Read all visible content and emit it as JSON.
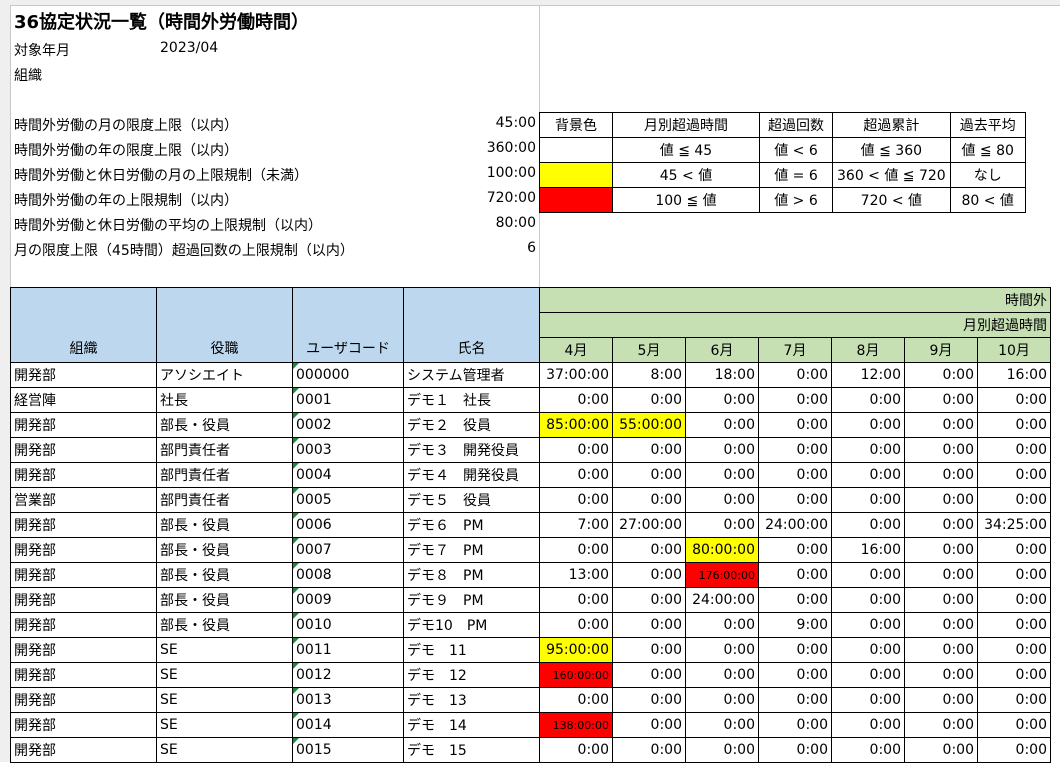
{
  "title": "36協定状況一覧（時間外労働時間）",
  "target_month_label": "対象年月",
  "target_month_value": "2023/04",
  "org_label": "組織",
  "limits": [
    {
      "label": "時間外労働の月の限度上限（以内）",
      "value": "45:00"
    },
    {
      "label": "時間外労働の年の限度上限（以内）",
      "value": "360:00"
    },
    {
      "label": "時間外労働と休日労働の月の上限規制（未満）",
      "value": "100:00"
    },
    {
      "label": "時間外労働の年の上限規制（以内）",
      "value": "720:00"
    },
    {
      "label": "時間外労働と休日労働の平均の上限規制（以内）",
      "value": "80:00"
    },
    {
      "label": "月の限度上限（45時間）超過回数の上限規制（以内）",
      "value": "6"
    }
  ],
  "legend": {
    "headers": [
      "背景色",
      "月別超過時間",
      "超過回数",
      "超過累計",
      "過去平均"
    ],
    "rows": [
      {
        "color": "#ffffff",
        "cells": [
          "値 ≦ 45",
          "値 < 6",
          "値 ≦ 360",
          "値 ≦ 80"
        ]
      },
      {
        "color": "#ffff00",
        "cells": [
          "45 < 値",
          "値 = 6",
          "360 < 値 ≦ 720",
          "なし"
        ]
      },
      {
        "color": "#ff0000",
        "cells": [
          "100 ≦ 値",
          "値 > 6",
          "720 < 値",
          "80 < 値"
        ]
      }
    ]
  },
  "grid": {
    "group_header": "時間外",
    "sub_header": "月別超過時間",
    "columns": [
      "組織",
      "役職",
      "ユーザコード",
      "氏名"
    ],
    "months": [
      "4月",
      "5月",
      "6月",
      "7月",
      "8月",
      "9月",
      "10月"
    ],
    "rows": [
      {
        "org": "開発部",
        "role": "アソシエイト",
        "code": "000000",
        "name": "システム管理者",
        "vals": [
          "37:00:00",
          "8:00",
          "18:00",
          "0:00",
          "12:00",
          "0:00",
          "16:00"
        ],
        "hl": [
          "",
          "",
          "",
          "",
          "",
          "",
          ""
        ]
      },
      {
        "org": "経営陣",
        "role": "社長",
        "code": "0001",
        "name": "デモ１　社長",
        "vals": [
          "0:00",
          "0:00",
          "0:00",
          "0:00",
          "0:00",
          "0:00",
          "0:00"
        ],
        "hl": [
          "",
          "",
          "",
          "",
          "",
          "",
          ""
        ]
      },
      {
        "org": "開発部",
        "role": "部長・役員",
        "code": "0002",
        "name": "デモ２　役員",
        "vals": [
          "85:00:00",
          "55:00:00",
          "0:00",
          "0:00",
          "0:00",
          "0:00",
          "0:00"
        ],
        "hl": [
          "y",
          "y",
          "",
          "",
          "",
          "",
          ""
        ]
      },
      {
        "org": "開発部",
        "role": "部門責任者",
        "code": "0003",
        "name": "デモ３　開発役員",
        "vals": [
          "0:00",
          "0:00",
          "0:00",
          "0:00",
          "0:00",
          "0:00",
          "0:00"
        ],
        "hl": [
          "",
          "",
          "",
          "",
          "",
          "",
          ""
        ]
      },
      {
        "org": "開発部",
        "role": "部門責任者",
        "code": "0004",
        "name": "デモ４　開発役員",
        "vals": [
          "0:00",
          "0:00",
          "0:00",
          "0:00",
          "0:00",
          "0:00",
          "0:00"
        ],
        "hl": [
          "",
          "",
          "",
          "",
          "",
          "",
          ""
        ]
      },
      {
        "org": "営業部",
        "role": "部門責任者",
        "code": "0005",
        "name": "デモ５　役員",
        "vals": [
          "0:00",
          "0:00",
          "0:00",
          "0:00",
          "0:00",
          "0:00",
          "0:00"
        ],
        "hl": [
          "",
          "",
          "",
          "",
          "",
          "",
          ""
        ]
      },
      {
        "org": "開発部",
        "role": "部長・役員",
        "code": "0006",
        "name": "デモ６　PM",
        "vals": [
          "7:00",
          "27:00:00",
          "0:00",
          "24:00:00",
          "0:00",
          "0:00",
          "34:25:00"
        ],
        "hl": [
          "",
          "",
          "",
          "",
          "",
          "",
          ""
        ]
      },
      {
        "org": "開発部",
        "role": "部長・役員",
        "code": "0007",
        "name": "デモ７　PM",
        "vals": [
          "0:00",
          "0:00",
          "80:00:00",
          "0:00",
          "16:00",
          "0:00",
          "0:00"
        ],
        "hl": [
          "",
          "",
          "y",
          "",
          "",
          "",
          ""
        ]
      },
      {
        "org": "開発部",
        "role": "部長・役員",
        "code": "0008",
        "name": "デモ８　PM",
        "vals": [
          "13:00",
          "0:00",
          "176:00:00",
          "0:00",
          "0:00",
          "0:00",
          "0:00"
        ],
        "hl": [
          "",
          "",
          "r",
          "",
          "",
          "",
          ""
        ]
      },
      {
        "org": "開発部",
        "role": "部長・役員",
        "code": "0009",
        "name": "デモ９　PM",
        "vals": [
          "0:00",
          "0:00",
          "24:00:00",
          "0:00",
          "0:00",
          "0:00",
          "0:00"
        ],
        "hl": [
          "",
          "",
          "",
          "",
          "",
          "",
          ""
        ]
      },
      {
        "org": "開発部",
        "role": "部長・役員",
        "code": "0010",
        "name": "デモ10　PM",
        "vals": [
          "0:00",
          "0:00",
          "0:00",
          "9:00",
          "0:00",
          "0:00",
          "0:00"
        ],
        "hl": [
          "",
          "",
          "",
          "",
          "",
          "",
          ""
        ]
      },
      {
        "org": "開発部",
        "role": "SE",
        "code": "0011",
        "name": "デモ　11",
        "vals": [
          "95:00:00",
          "0:00",
          "0:00",
          "0:00",
          "0:00",
          "0:00",
          "0:00"
        ],
        "hl": [
          "y",
          "",
          "",
          "",
          "",
          "",
          ""
        ]
      },
      {
        "org": "開発部",
        "role": "SE",
        "code": "0012",
        "name": "デモ　12",
        "vals": [
          "160:00:00",
          "0:00",
          "0:00",
          "0:00",
          "0:00",
          "0:00",
          "0:00"
        ],
        "hl": [
          "r",
          "",
          "",
          "",
          "",
          "",
          ""
        ]
      },
      {
        "org": "開発部",
        "role": "SE",
        "code": "0013",
        "name": "デモ　13",
        "vals": [
          "0:00",
          "0:00",
          "0:00",
          "0:00",
          "0:00",
          "0:00",
          "0:00"
        ],
        "hl": [
          "",
          "",
          "",
          "",
          "",
          "",
          ""
        ]
      },
      {
        "org": "開発部",
        "role": "SE",
        "code": "0014",
        "name": "デモ　14",
        "vals": [
          "138:00:00",
          "0:00",
          "0:00",
          "0:00",
          "0:00",
          "0:00",
          "0:00"
        ],
        "hl": [
          "r",
          "",
          "",
          "",
          "",
          "",
          ""
        ]
      },
      {
        "org": "開発部",
        "role": "SE",
        "code": "0015",
        "name": "デモ　15",
        "vals": [
          "0:00",
          "0:00",
          "0:00",
          "0:00",
          "0:00",
          "0:00",
          "0:00"
        ],
        "hl": [
          "",
          "",
          "",
          "",
          "",
          "",
          ""
        ]
      }
    ]
  }
}
